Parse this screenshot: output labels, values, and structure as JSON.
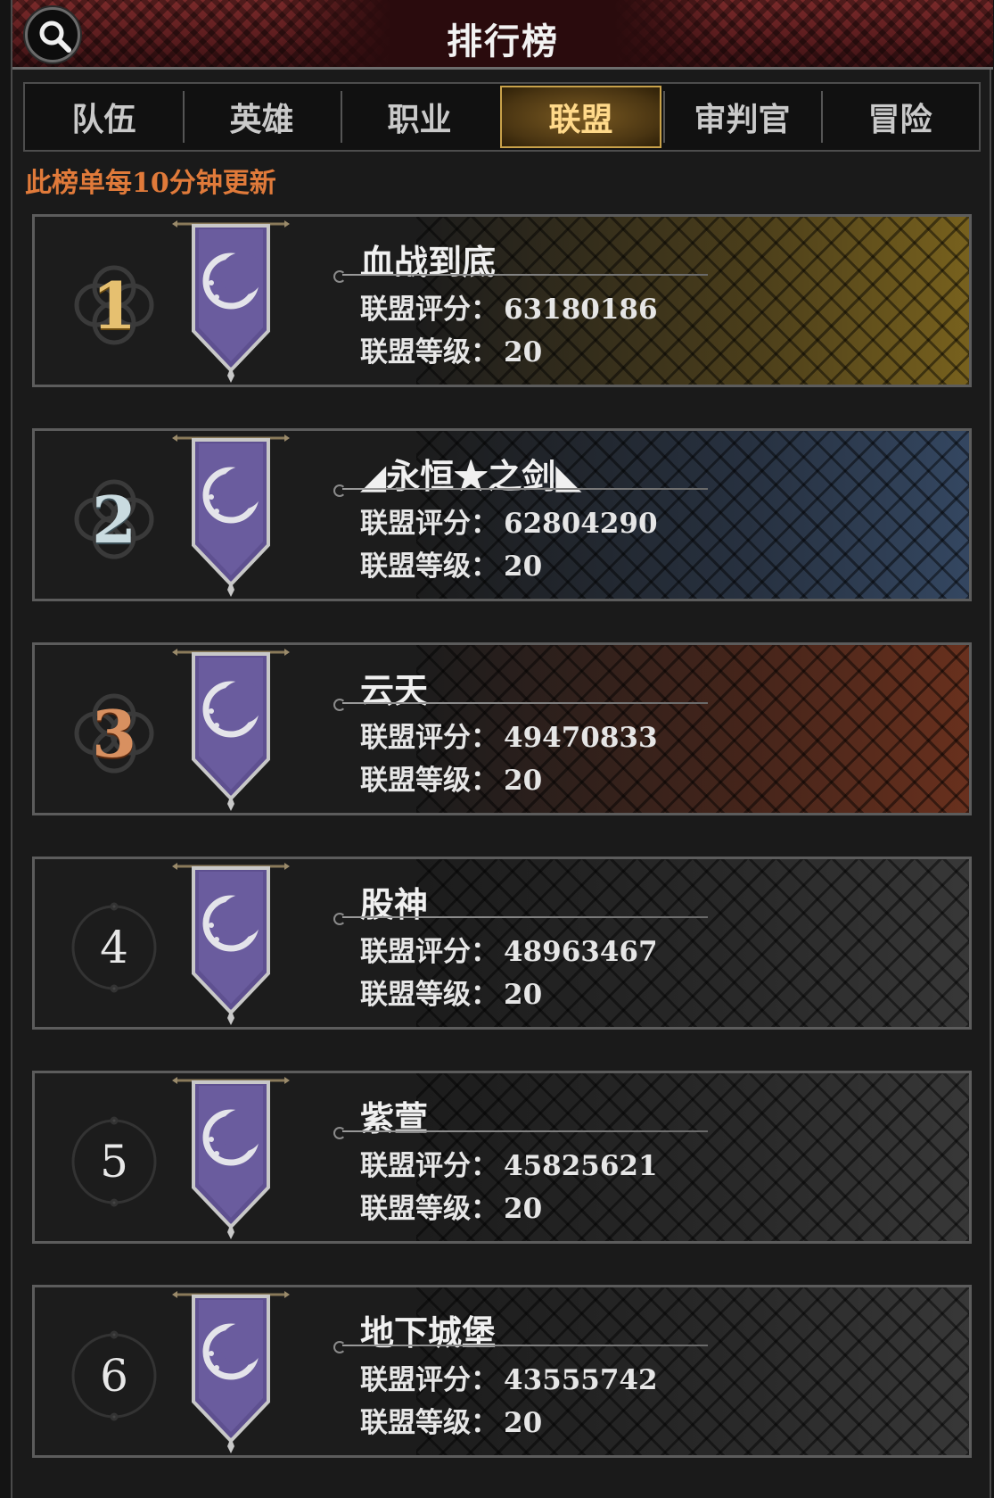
{
  "header": {
    "title": "排行榜"
  },
  "tabs": [
    {
      "label": "队伍",
      "active": false
    },
    {
      "label": "英雄",
      "active": false
    },
    {
      "label": "职业",
      "active": false
    },
    {
      "label": "联盟",
      "active": true
    },
    {
      "label": "审判官",
      "active": false
    },
    {
      "label": "冒险",
      "active": false
    }
  ],
  "notice": "此榜单每10分钟更新",
  "labels": {
    "score": "联盟评分：",
    "level": "联盟等级："
  },
  "entries": [
    {
      "rank": "1",
      "name": "血战到底",
      "score": "63180186",
      "level": "20"
    },
    {
      "rank": "2",
      "name": "◢永恒★之剑◣",
      "score": "62804290",
      "level": "20"
    },
    {
      "rank": "3",
      "name": "云天",
      "score": "49470833",
      "level": "20"
    },
    {
      "rank": "4",
      "name": "股神",
      "score": "48963467",
      "level": "20"
    },
    {
      "rank": "5",
      "name": "紫萱",
      "score": "45825621",
      "level": "20"
    },
    {
      "rank": "6",
      "name": "地下城堡",
      "score": "43555742",
      "level": "20"
    }
  ],
  "colors": {
    "accent_gold": "#c9a24a",
    "notice_orange": "#e07a3a",
    "rank1": "#e6c070",
    "rank2": "#c9dbe0",
    "rank3": "#d89060",
    "banner_purple": "#6a5a9a"
  },
  "icons": {
    "search": "search-icon",
    "banner": "guild-banner-icon",
    "emblem": "rank-emblem-icon"
  }
}
